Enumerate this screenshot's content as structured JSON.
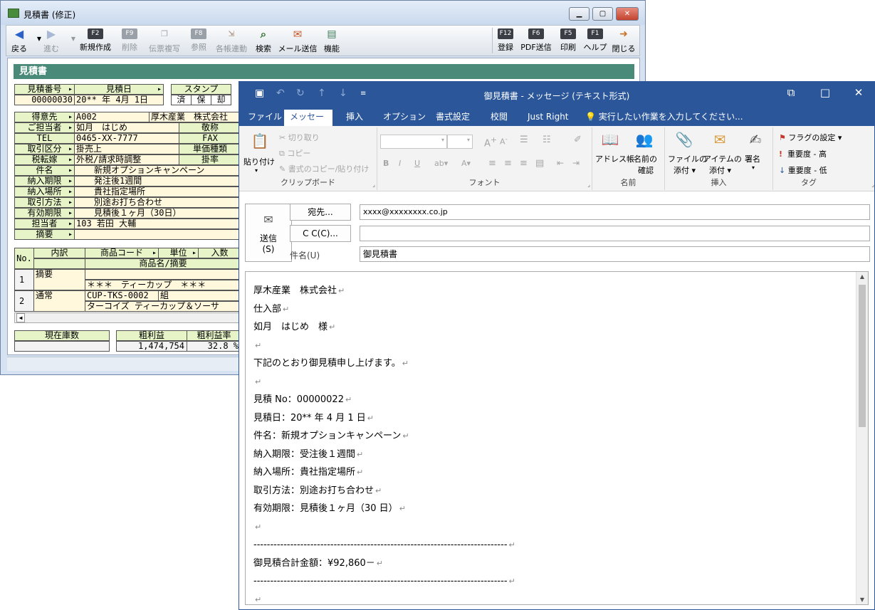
{
  "back_window": {
    "title": "見積書 (修正)",
    "toolbar": [
      {
        "key": "",
        "label": "戻る",
        "icon": "back-arrow-icon",
        "disabled": false
      },
      {
        "key": "",
        "label": "進む",
        "icon": "forward-arrow-icon",
        "disabled": true
      },
      {
        "key": "F2",
        "label": "新規作成",
        "disabled": false
      },
      {
        "key": "F9",
        "label": "削除",
        "disabled": true
      },
      {
        "key": "",
        "label": "伝票複写",
        "icon": "copy-icon",
        "disabled": true
      },
      {
        "key": "F8",
        "label": "参照",
        "disabled": true
      },
      {
        "key": "",
        "label": "各帳連動",
        "icon": "link-icon",
        "disabled": true
      },
      {
        "key": "",
        "label": "検索",
        "icon": "magnifier-icon",
        "disabled": false
      },
      {
        "key": "",
        "label": "メール送信",
        "icon": "mail-icon",
        "disabled": false
      },
      {
        "key": "",
        "label": "機能",
        "icon": "function-icon",
        "disabled": false
      },
      {
        "key": "F12",
        "label": "登録",
        "disabled": false
      },
      {
        "key": "F6",
        "label": "PDF送信",
        "disabled": false
      },
      {
        "key": "F5",
        "label": "印刷",
        "disabled": false
      },
      {
        "key": "F1",
        "label": "ヘルプ",
        "disabled": false
      },
      {
        "key": "",
        "label": "閉じる",
        "icon": "exit-icon",
        "disabled": false
      }
    ],
    "section_title": "見積書",
    "form": {
      "estimate_no_label": "見積番号",
      "estimate_no": "00000030",
      "estimate_date_label": "見積日",
      "estimate_date": "20** 年  4月  1日",
      "stamp_label": "スタンプ",
      "stamp_cells": [
        "済",
        "保",
        "却"
      ],
      "customer_label": "得意先",
      "customer_code": "A002",
      "customer_name": "厚木産業　株式会社",
      "contact_label": "ご担当者",
      "contact_name": "如月　はじめ",
      "honorific_label": "敬称",
      "tel_label": "TEL",
      "tel": "0465-XX-7777",
      "fax_label": "FAX",
      "trade_type_label": "取引区分",
      "trade_type": "掛売上",
      "unit_price_type_label": "単価種類",
      "tax_transfer_label": "税転嫁",
      "tax_transfer": "外税/請求時調整",
      "rate_label": "掛率",
      "subject_label": "件名",
      "subject": "新規オプションキャンペーン",
      "delivery_period_label": "納入期限",
      "delivery_period": "発注後1週間",
      "delivery_place_label": "納入場所",
      "delivery_place": "貴社指定場所",
      "payment_label": "取引方法",
      "payment": "別途お打ち合わせ",
      "validity_label": "有効期限",
      "validity": "見積後１ヶ月（30日）",
      "staff_label": "担当者",
      "staff": "103 若田 大輔",
      "memo_label": "摘要"
    },
    "lines": {
      "headers": {
        "no": "No.",
        "detail": "内訳",
        "product_code": "商品コード",
        "unit": "単位",
        "quantity": "入数",
        "product_name": "商品名/摘要"
      },
      "rows": [
        {
          "no": "1",
          "detail": "摘要",
          "code": "",
          "unit": "",
          "name": "＊＊＊　ティーカップ　＊＊＊"
        },
        {
          "no": "2",
          "detail": "通常",
          "code": "CUP-TKS-0002",
          "unit": "組",
          "name": "ターコイズ ティーカップ＆ソーサ"
        }
      ]
    },
    "summary": {
      "stock_label": "現在庫数",
      "stock": "",
      "gross_profit_label": "粗利益",
      "gross_profit": "1,474,754",
      "gross_margin_label": "粗利益率",
      "gross_margin": "32.8 %"
    }
  },
  "mail_window": {
    "title": "御見積書 - メッセージ (テキスト形式)",
    "tabs": [
      "ファイル",
      "メッセージ",
      "挿入",
      "オプション",
      "書式設定",
      "校閲",
      "Just Right",
      "実行したい作業を入力してください..."
    ],
    "active_tab": "メッセージ",
    "ribbon": {
      "clipboard": {
        "group": "クリップボード",
        "paste": "貼り付け",
        "cut": "切り取り",
        "copy": "コピー",
        "format_painter": "書式のコピー/貼り付け"
      },
      "font": {
        "group": "フォント"
      },
      "names": {
        "group": "名前",
        "address_book": "アドレス帳",
        "check_names_1": "名前の",
        "check_names_2": "確認"
      },
      "insert": {
        "group": "挿入",
        "attach_file_1": "ファイルの",
        "attach_file_2": "添付",
        "attach_item_1": "アイテムの",
        "attach_item_2": "添付",
        "signature": "署名"
      },
      "tags": {
        "group": "タグ",
        "follow_up": "フラグの設定",
        "high": "重要度 - 高",
        "low": "重要度 - 低"
      }
    },
    "header": {
      "send_1": "送信",
      "send_2": "(S)",
      "to_button": "宛先...",
      "to_value": "xxxx@xxxxxxxx.co.jp",
      "cc_button": "C C(C)...",
      "cc_value": "",
      "subject_label": "件名(U)",
      "subject_value": "御見積書"
    },
    "body_lines": [
      "厚木産業　株式会社",
      "仕入部",
      "如月　はじめ　様",
      "",
      "下記のとおり御見積申し上げます。",
      "",
      "見積 No：00000022",
      "見積日：20** 年  4 月  1 日",
      "件名：新規オプションキャンペーン",
      "納入期限：受注後１週間",
      "納入場所：貴社指定場所",
      "取引方法：別途お打ち合わせ",
      "有効期限：見積後１ヶ月（30 日）",
      "",
      "----------------------------------------------------------------------------",
      "御見積合計金額：¥92,860－",
      "----------------------------------------------------------------------------",
      ""
    ],
    "return_mark": "↵"
  },
  "colors": {
    "outlook_blue": "#2b579a",
    "section_green": "#4a8a78",
    "label_green": "#e6f4c8",
    "input_cream": "#fff8dc"
  }
}
